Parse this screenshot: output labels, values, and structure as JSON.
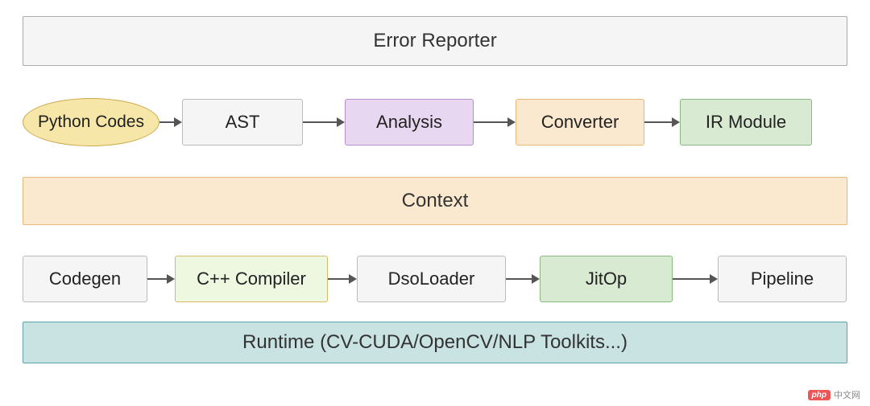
{
  "rows": {
    "error_reporter": "Error Reporter",
    "context": "Context",
    "runtime": "Runtime (CV-CUDA/OpenCV/NLP Toolkits...)"
  },
  "pipeline1": {
    "python_codes": "Python Codes",
    "ast": "AST",
    "analysis": "Analysis",
    "converter": "Converter",
    "ir_module": "IR Module"
  },
  "pipeline2": {
    "codegen": "Codegen",
    "cpp_compiler": "C++ Compiler",
    "dso_loader": "DsoLoader",
    "jitop": "JitOp",
    "pipeline": "Pipeline"
  },
  "watermark": {
    "badge": "php",
    "text": "中文网"
  }
}
